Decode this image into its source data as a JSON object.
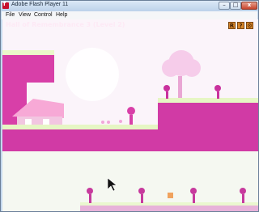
{
  "window": {
    "title": "Adobe Flash Player 11",
    "app_icon_glyph": "f",
    "controls": {
      "minimize": "–",
      "maximize": "□",
      "close": "x"
    }
  },
  "menu": {
    "items": [
      "File",
      "View",
      "Control",
      "Help"
    ]
  },
  "game": {
    "level_title": "Hall of Remembrance 3 (Level 2)",
    "hud_buttons": [
      "R",
      "?",
      "⚙"
    ],
    "colors": {
      "ground": "#d13aa5",
      "grass": "#e6f6c4",
      "sky": "#fbf4fa"
    }
  }
}
